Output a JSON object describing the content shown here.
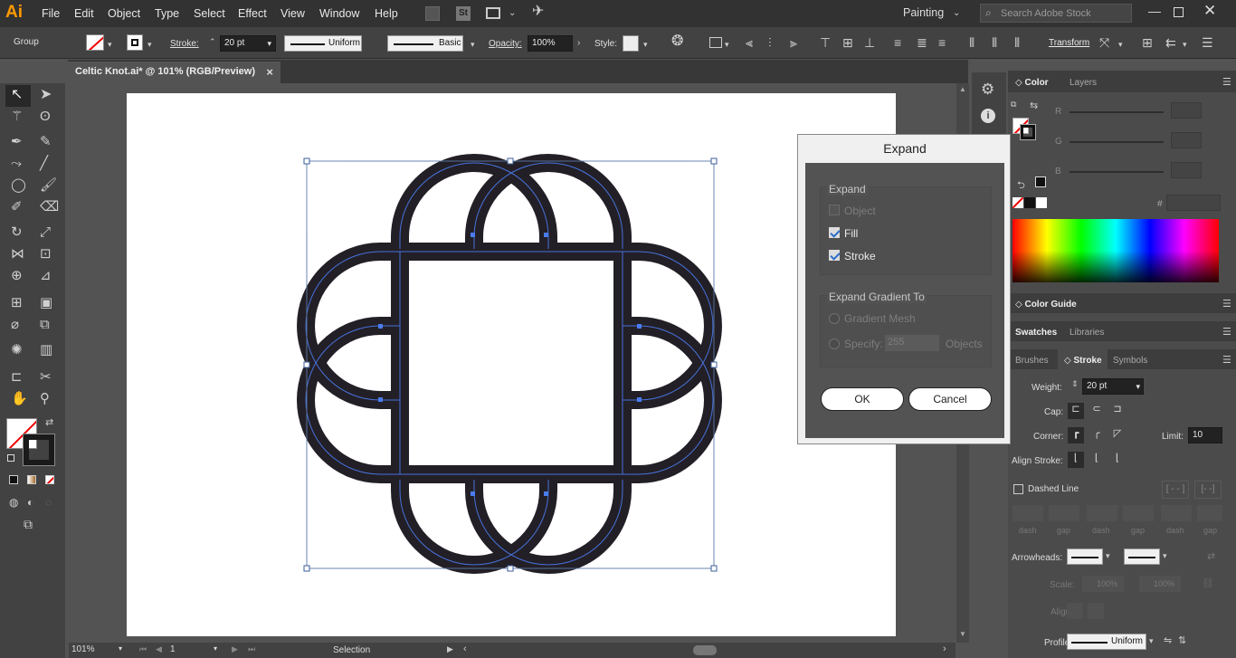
{
  "app": {
    "logo": "Ai",
    "workspace": "Painting",
    "search_placeholder": "Search Adobe Stock"
  },
  "menu": [
    "File",
    "Edit",
    "Object",
    "Type",
    "Select",
    "Effect",
    "View",
    "Window",
    "Help"
  ],
  "control": {
    "selection_type": "Group",
    "stroke_label": "Stroke:",
    "stroke_weight": "20 pt",
    "profile": "Uniform",
    "brush": "Basic",
    "opacity_label": "Opacity:",
    "opacity": "100%",
    "style_label": "Style:",
    "transform": "Transform"
  },
  "document": {
    "tab_title": "Celtic Knot.ai* @ 101% (RGB/Preview)",
    "close": "×"
  },
  "status": {
    "zoom": "101%",
    "artboard": "1",
    "tool": "Selection"
  },
  "panels": {
    "color_tab": "Color",
    "layers_tab": "Layers",
    "channels": [
      "R",
      "G",
      "B"
    ],
    "hex_label": "#",
    "color_guide": "Color Guide",
    "swatches_tab": "Swatches",
    "libraries_tab": "Libraries",
    "brushes_tab": "Brushes",
    "stroke_tab": "Stroke",
    "symbols_tab": "Symbols",
    "weight_label": "Weight:",
    "weight_value": "20 pt",
    "cap_label": "Cap:",
    "corner_label": "Corner:",
    "limit_label": "Limit:",
    "limit_value": "10",
    "align_label": "Align Stroke:",
    "dashed_label": "Dashed Line",
    "dash_labels": [
      "dash",
      "gap",
      "dash",
      "gap",
      "dash",
      "gap"
    ],
    "arrowheads_label": "Arrowheads:",
    "scale_label": "Scale:",
    "scale1": "100%",
    "scale2": "100%",
    "align2_label": "Align:",
    "profile_label": "Profile:",
    "profile_value": "Uniform"
  },
  "dialog": {
    "title": "Expand",
    "group1": "Expand",
    "object": "Object",
    "fill": "Fill",
    "stroke": "Stroke",
    "group2": "Expand Gradient To",
    "gradient_mesh": "Gradient Mesh",
    "specify": "Specify:",
    "specify_value": "255",
    "objects": "Objects",
    "ok": "OK",
    "cancel": "Cancel"
  },
  "colors": {
    "accent": "#4a7cf0",
    "knot": "#231f26",
    "logo": "#ff9a00"
  }
}
